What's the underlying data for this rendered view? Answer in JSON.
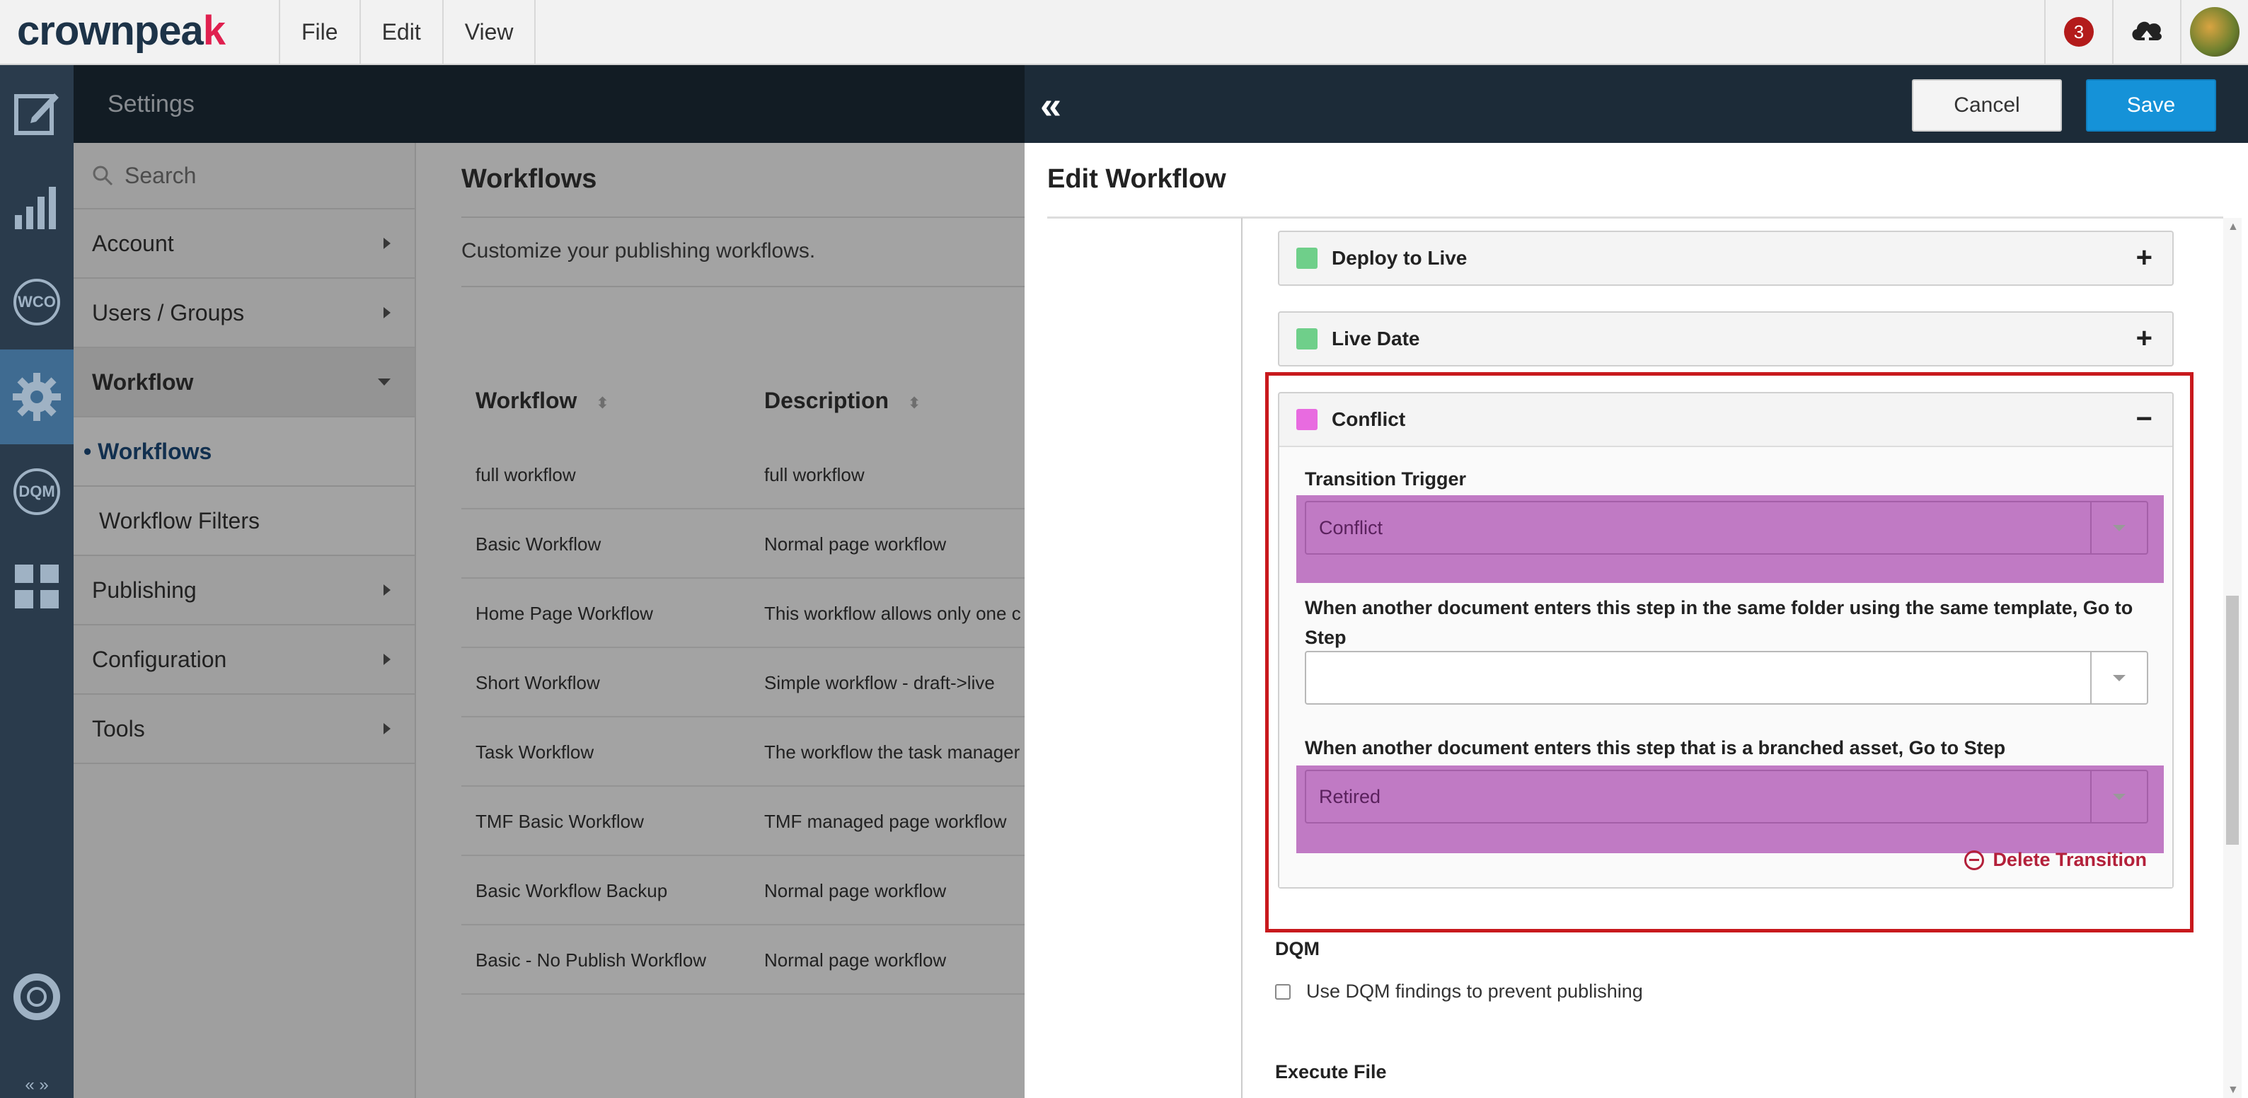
{
  "app": {
    "logo_text": "crownpeak",
    "menus": [
      "File",
      "Edit",
      "View"
    ],
    "notification_count": "3",
    "accent_color": "#1592d8",
    "rail_icons": [
      "edit-icon",
      "analytics-icon",
      "wco-icon",
      "settings-gear-icon",
      "dqm-icon",
      "modules-icon",
      "help-lifebuoy-icon"
    ],
    "rail_labels": {
      "wco": "WCO",
      "dqm": "DQM"
    },
    "rail_bottom": "« »"
  },
  "settings": {
    "title": "Settings",
    "search_placeholder": "Search",
    "nav": [
      {
        "label": "Account"
      },
      {
        "label": "Users / Groups"
      },
      {
        "label": "Workflow"
      },
      {
        "label": "• Workflows"
      },
      {
        "label": "Workflow Filters"
      },
      {
        "label": "Publishing"
      },
      {
        "label": "Configuration"
      },
      {
        "label": "Tools"
      }
    ]
  },
  "main": {
    "title": "Workflows",
    "description": "Customize your publishing workflows.",
    "columns": [
      "Workflow",
      "Description"
    ],
    "rows": [
      [
        "full workflow",
        "full workflow"
      ],
      [
        "Basic Workflow",
        "Normal page workflow"
      ],
      [
        "Home Page Workflow",
        "This workflow allows only one c"
      ],
      [
        "Short Workflow",
        "Simple workflow - draft->live"
      ],
      [
        "Task Workflow",
        "The workflow the task manager"
      ],
      [
        "TMF Basic Workflow",
        "TMF managed page workflow"
      ],
      [
        "Basic Workflow Backup",
        "Normal page workflow"
      ],
      [
        "Basic - No Publish Workflow",
        "Normal page workflow"
      ]
    ]
  },
  "panel": {
    "cancel_label": "Cancel",
    "save_label": "Save",
    "title": "Edit Workflow",
    "steps": [
      {
        "name": "Deploy to Live",
        "color": "#6fcf8a",
        "sign": "+"
      },
      {
        "name": "Live Date",
        "color": "#6fcf8a",
        "sign": "+"
      },
      {
        "name": "Conflict",
        "color": "#e86be0",
        "sign": "−"
      }
    ],
    "conflict": {
      "trigger_label": "Transition Trigger",
      "trigger_value": "Conflict",
      "same_folder_label": "When another document enters this step in the same folder using the same template, Go to Step",
      "same_folder_value": "",
      "branched_label": "When another document enters this step that is a branched asset, Go to Step",
      "branched_value": "Retired",
      "delete_label": "Delete Transition"
    },
    "dqm": {
      "title": "DQM",
      "checkbox_label": "Use DQM findings to prevent publishing"
    },
    "execute_file_title": "Execute File"
  }
}
